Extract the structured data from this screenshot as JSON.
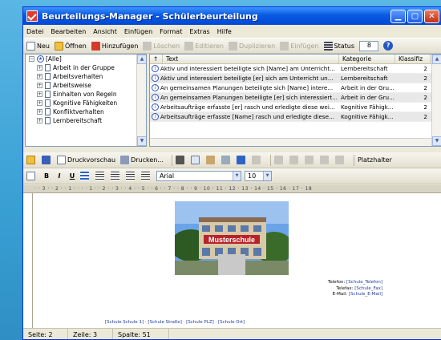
{
  "window": {
    "title": "Beurteilungs-Manager - Schülerbeurteilung"
  },
  "menu": [
    "Datei",
    "Bearbeiten",
    "Ansicht",
    "Einfügen",
    "Format",
    "Extras",
    "Hilfe"
  ],
  "toolbar": {
    "new_label": "Neu",
    "open_label": "Öffnen",
    "add_label": "Hinzufügen",
    "delete_label": "Löschen",
    "edit_label": "Editieren",
    "duplicate_label": "Duplizieren",
    "insert_label": "Einfügen",
    "status_label": "Status",
    "status_value": "8"
  },
  "tree": {
    "root": "[Alle]",
    "items": [
      "Arbeit in der Gruppe",
      "Arbeitsverhalten",
      "Arbeitsweise",
      "Einhalten von Regeln",
      "Kognitive Fähigkeiten",
      "Konfliktverhalten",
      "Lernbereitschaft"
    ]
  },
  "table": {
    "columns": [
      "Text",
      "Kategorie",
      "Klassifiz"
    ],
    "rows": [
      {
        "text": "Aktiv und interessiert beteiligte sich [Name] am Unterricht...",
        "category": "Lernbereitschaft",
        "class": "2"
      },
      {
        "text": "Aktiv und interessiert beteiligte [er] sich am Unterricht un...",
        "category": "Lernbereitschaft",
        "class": "2"
      },
      {
        "text": "An gemeinsamen Planungen beteiligte sich [Name] intere...",
        "category": "Arbeit in der Gru...",
        "class": "2"
      },
      {
        "text": "An gemeinsamen Planungen beteiligte [er] sich interessiert...",
        "category": "Arbeit in der Gru...",
        "class": "2"
      },
      {
        "text": "Arbeitsaufträge erfasste [er] rasch und erledigte diese wei...",
        "category": "Kognitive Fähigk...",
        "class": "2"
      },
      {
        "text": "Arbeitsaufträge erfasste [Name] rasch und erledigte diese...",
        "category": "Kognitive Fähigk...",
        "class": "2"
      }
    ]
  },
  "editor_toolbar": {
    "print_preview_label": "Druckvorschau",
    "print_label": "Drucken...",
    "placeholder_label": "Platzhalter"
  },
  "format_toolbar": {
    "bold": "B",
    "italic": "I",
    "underline": "U",
    "font": "Arial",
    "size": "10"
  },
  "ruler_text": "· · 3 · · 2 · · 1 · · · · 1 · · 2 · · 3 · · 4 · · 5 · · 6 · · 7 · · 8 · · 9 · 10 · 11 · 12 · 13 · 14 · 15 · 16 · 17 · 18",
  "document": {
    "school_sign": "Musterschule",
    "contact": [
      {
        "label": "Telefon:",
        "value": "[Schule_Telefon]"
      },
      {
        "label": "Telefax:",
        "value": "[Schule_Fax]"
      },
      {
        "label": "E-Mail:",
        "value": "[Schule_E-Mail]"
      }
    ],
    "footer": "[Schule Schule 1] · [Schule Straße] · [Schule PLZ] · [Schule Ort]"
  },
  "statusbar": {
    "page": "Seite: 2",
    "line": "Zeile: 3",
    "column": "Spalte: 51"
  },
  "colors": {
    "titlebar": "#0a5ae0",
    "accent": "#1d3b9c",
    "desktop": "#3fa3d6"
  }
}
